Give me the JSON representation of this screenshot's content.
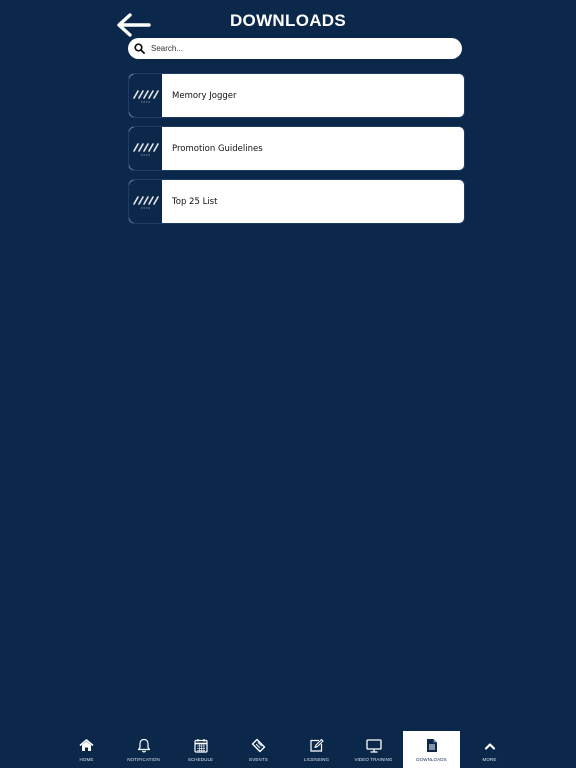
{
  "header": {
    "title": "DOWNLOADS"
  },
  "search": {
    "placeholder": "Search..."
  },
  "downloads": [
    {
      "label": "Memory Jogger"
    },
    {
      "label": "Promotion Guidelines"
    },
    {
      "label": "Top 25 List"
    }
  ],
  "tabs": [
    {
      "label": "HOME",
      "icon": "home-icon"
    },
    {
      "label": "NOTIFICATION",
      "icon": "bell-icon"
    },
    {
      "label": "SCHEDULE",
      "icon": "calendar-icon"
    },
    {
      "label": "EVENTS",
      "icon": "ticket-icon"
    },
    {
      "label": "LICENSING",
      "icon": "edit-icon"
    },
    {
      "label": "VIDEO TRAINING",
      "icon": "monitor-icon"
    },
    {
      "label": "DOWNLOADS",
      "icon": "document-icon",
      "active": true
    },
    {
      "label": "MORE",
      "icon": "chevron-up-icon"
    }
  ],
  "colors": {
    "background": "#0b284b",
    "card": "#ffffff",
    "active_tab": "#ffffff"
  }
}
